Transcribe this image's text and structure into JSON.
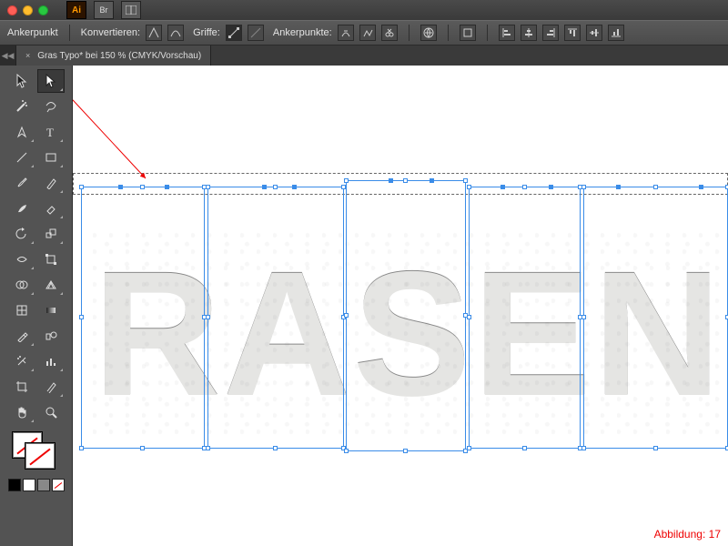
{
  "titlebar": {
    "app_abbrev": "Ai",
    "bridge_abbr": "Br"
  },
  "optionbar": {
    "label_anchor": "Ankerpunkt",
    "label_convert": "Konvertieren:",
    "label_handles": "Griffe:",
    "label_anchors": "Ankerpunkte:"
  },
  "tab": {
    "close": "×",
    "title": "Gras Typo* bei 150 % (CMYK/Vorschau)"
  },
  "canvas": {
    "text": "RASEN"
  },
  "caption": {
    "label": "Abbildung:",
    "num": "17"
  },
  "tooltips": {
    "selection": "Auswahl-Werkzeug",
    "direct_sel": "Direktauswahl-Werkzeug"
  }
}
